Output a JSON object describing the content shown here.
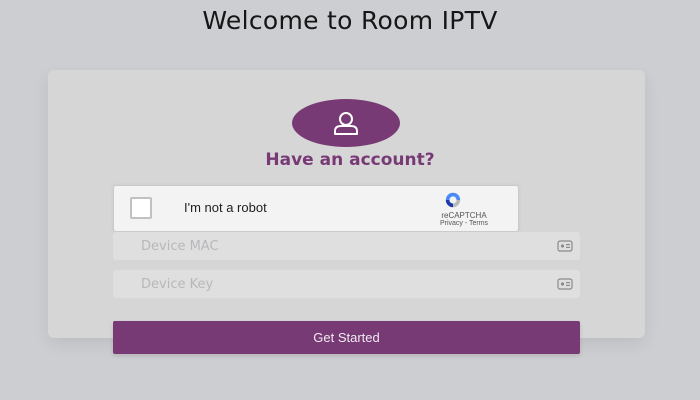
{
  "page": {
    "title": "Welcome to Room IPTV"
  },
  "login": {
    "avatar_icon": "user-icon",
    "heading": "Have an account?"
  },
  "captcha": {
    "label": "I'm not a robot",
    "brand": "reCAPTCHA",
    "links": "Privacy - Terms",
    "checked": false,
    "logo_icon": "recaptcha-logo-icon"
  },
  "fields": {
    "device_mac": {
      "placeholder": "Device MAC",
      "value": "",
      "icon": "id-card-icon"
    },
    "device_key": {
      "placeholder": "Device Key",
      "value": "",
      "icon": "id-card-icon"
    }
  },
  "actions": {
    "submit_label": "Get Started"
  },
  "colors": {
    "background": "#cdced2",
    "card": "#d6d6d7",
    "accent": "#773a74",
    "title_text": "#161616",
    "input_background": "#dfdfe0"
  }
}
